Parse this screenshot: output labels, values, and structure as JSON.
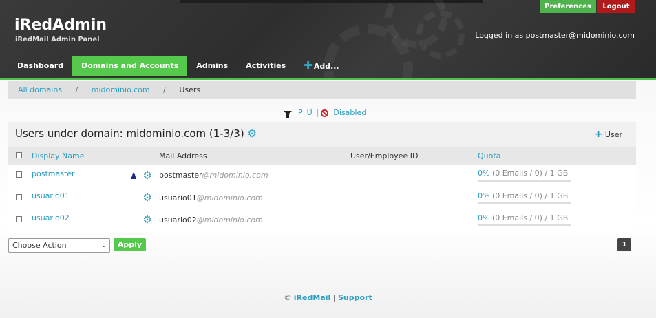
{
  "header": {
    "title": "iRedAdmin",
    "subtitle": "iRedMail Admin Panel",
    "preferences_label": "Preferences",
    "logout_label": "Logout",
    "logged_in_text": "Logged in as postmaster@midominio.com"
  },
  "nav": {
    "dashboard": "Dashboard",
    "domains_accounts": "Domains and Accounts",
    "admins": "Admins",
    "activities": "Activities",
    "add": "Add..."
  },
  "breadcrumb": {
    "all_domains": "All domains",
    "domain": "midominio.com",
    "current": "Users"
  },
  "filter": {
    "p": "P",
    "u": "U",
    "disabled": "Disabled"
  },
  "panel": {
    "title": "Users under domain: midominio.com (1-3/3)",
    "add_user": "User"
  },
  "table": {
    "headers": {
      "display_name": "Display Name",
      "mail_address": "Mail Address",
      "employee_id": "User/Employee ID",
      "quota": "Quota"
    },
    "rows": [
      {
        "name": "postmaster",
        "local": "postmaster",
        "domain": "@midominio.com",
        "emp": "",
        "quota_pct": "0%",
        "quota_rest": " (0 Emails / 0) / 1 GB",
        "is_admin": true
      },
      {
        "name": "usuario01",
        "local": "usuario01",
        "domain": "@midominio.com",
        "emp": "",
        "quota_pct": "0%",
        "quota_rest": " (0 Emails / 0) / 1 GB",
        "is_admin": false
      },
      {
        "name": "usuario02",
        "local": "usuario02",
        "domain": "@midominio.com",
        "emp": "",
        "quota_pct": "0%",
        "quota_rest": " (0 Emails / 0) / 1 GB",
        "is_admin": false
      }
    ]
  },
  "actions": {
    "choose_action": "Choose Action",
    "apply": "Apply",
    "page": "1"
  },
  "footer": {
    "copyright": "©",
    "iredmail": "iRedMail",
    "separator": "|",
    "support": "Support"
  },
  "colors": {
    "accent_green": "#55c94b",
    "logout_red": "#b11a1a",
    "link_blue": "#2a9dc2"
  }
}
